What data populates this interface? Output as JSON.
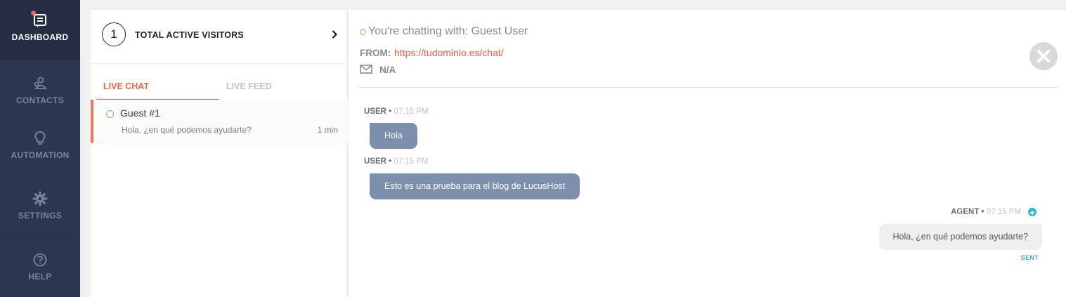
{
  "sidebar": {
    "items": [
      {
        "label": "DASHBOARD",
        "icon": "dashboard-icon",
        "active": true
      },
      {
        "label": "CONTACTS",
        "icon": "contacts-icon",
        "active": false
      },
      {
        "label": "AUTOMATION",
        "icon": "lightbulb-icon",
        "active": false
      },
      {
        "label": "SETTINGS",
        "icon": "gear-icon",
        "active": false
      },
      {
        "label": "HELP",
        "icon": "help-icon",
        "active": false
      }
    ]
  },
  "visitors": {
    "count": "1",
    "label": "TOTAL ACTIVE VISITORS",
    "tabs": [
      {
        "label": "LIVE CHAT",
        "active": true
      },
      {
        "label": "LIVE FEED",
        "active": false
      }
    ],
    "chats": [
      {
        "name": "Guest #1",
        "preview": "Hola, ¿en qué podemos ayudarte?",
        "time": "1 min",
        "status": "online"
      }
    ]
  },
  "chat": {
    "chatting_with": "You're chatting with: Guest User",
    "from_label": "FROM:",
    "from_url": "https://tudominio.es/chat/",
    "email": "N/A",
    "messages": [
      {
        "sender": "USER",
        "time": "07:15 PM",
        "text": "Hola"
      },
      {
        "sender": "USER",
        "time": "07:15 PM",
        "text": "Esto es una prueba para el blog de LucusHost"
      },
      {
        "sender": "AGENT",
        "time": "07:15 PM",
        "text": "Hola, ¿en qué podemos ayudarte?",
        "status": "SENT"
      }
    ]
  },
  "colors": {
    "sidebar": "#2c3650",
    "accent": "#ef6548",
    "online": "#7fbf4d",
    "user_bubble": "#7c8fab",
    "agent_bubble": "#efefef",
    "link": "#ef5a3c"
  }
}
